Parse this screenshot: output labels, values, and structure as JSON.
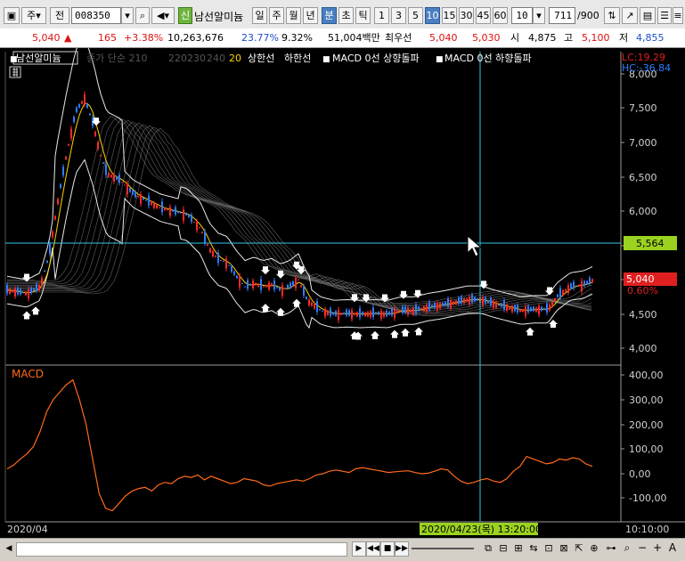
{
  "toolbar": {
    "market_label": "주",
    "prev_label": "전",
    "code": "008350",
    "new_label": "신",
    "stock_name": "남선알미늄",
    "period_buttons": [
      "일",
      "주",
      "월",
      "년",
      "분",
      "초",
      "틱"
    ],
    "interval_buttons": [
      "1",
      "3",
      "5",
      "10",
      "15",
      "30",
      "45",
      "60"
    ],
    "interval_value": "10",
    "count_value": "711",
    "count_total": "/900"
  },
  "quote": {
    "price": "5,040",
    "change": "165",
    "change_pct": "+3.38%",
    "volume": "10,263,676",
    "turnover_pct": "23.77%",
    "ratio_pct": "9.32%",
    "amount": "51,004백만",
    "seller_label": "최우선",
    "ask": "5,040",
    "bid": "5,030",
    "open_label": "시",
    "open": "4,875",
    "high_label": "고",
    "high": "5,100",
    "low_label": "저",
    "low": "4,855"
  },
  "chart": {
    "stock_tag": "남선알미늄",
    "legend": [
      "종가 단순 210",
      "220",
      "230",
      "240",
      "20",
      "상한선",
      "하한선",
      "MACD 0선 상향돌파",
      "MACD 0선 하향돌파"
    ],
    "lc_label": "LC:19.29",
    "hc_label": "HC:-36.84",
    "price_axis": [
      "8,000",
      "7,500",
      "7,000",
      "6,500",
      "6,000",
      "5,500",
      "5,000",
      "4,500",
      "4,000"
    ],
    "crosshair_value": "5,564",
    "last_price": "5,040",
    "last_pct": "0.60%",
    "macd_label": "MACD",
    "macd_axis": [
      "400,00",
      "300,00",
      "200,00",
      "100,00",
      "0,00",
      "-100,00"
    ],
    "date_left": "2020/04",
    "crosshair_date": "2020/04/23(목) 13:20:00",
    "time_right": "10:10:00",
    "colors": {
      "up": "#ff2a2a",
      "down": "#2f7dff",
      "macd": "#ff6a1a",
      "cross": "#35c6e8",
      "highlight": "#9bd21f"
    }
  },
  "chart_data": {
    "type": "line",
    "title": "",
    "series": [
      {
        "name": "MACD",
        "values": [
          20,
          35,
          60,
          80,
          110,
          170,
          250,
          300,
          330,
          360,
          380,
          300,
          200,
          60,
          -80,
          -140,
          -150,
          -120,
          -90,
          -70,
          -60,
          -55,
          -70,
          -45,
          -35,
          -40,
          -20,
          -10,
          -15,
          -5,
          -25,
          -10,
          -20,
          -30,
          -40,
          -35,
          -20,
          -25,
          -30,
          -45,
          -50,
          -40,
          -35,
          -30,
          -25,
          -30,
          -20,
          -5,
          0,
          10,
          15,
          10,
          5,
          20,
          25,
          20,
          15,
          10,
          5,
          8,
          10,
          12,
          5,
          0,
          2,
          10,
          20,
          15,
          -10,
          -30,
          -40,
          -35,
          -25,
          -20,
          -30,
          -35,
          -20,
          10,
          30,
          70,
          60,
          50,
          40,
          45,
          60,
          55,
          65,
          60,
          40,
          30
        ]
      }
    ],
    "ylim": [
      -150,
      400
    ]
  }
}
